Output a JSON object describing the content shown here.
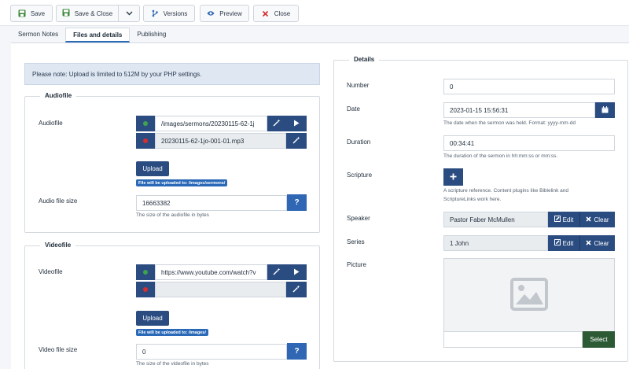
{
  "toolbar": {
    "save": "Save",
    "save_close": "Save & Close",
    "versions": "Versions",
    "preview": "Preview",
    "close": "Close"
  },
  "tabs": [
    {
      "label": "Sermon Notes"
    },
    {
      "label": "Files and details"
    },
    {
      "label": "Publishing"
    }
  ],
  "notice": "Please note: Upload is limited to 512M by your PHP settings.",
  "audio": {
    "legend": "Audiofile",
    "label": "Audiofile",
    "path": "/images/sermons/20230115-62-1j",
    "file": "20230115-62-1jo-001-01.mp3",
    "upload": "Upload",
    "upload_hint": "File will be uploaded to: /images/sermons/",
    "size_label": "Audio file size",
    "size_value": "16663382",
    "size_hint": "The size of the audiofile in bytes"
  },
  "video": {
    "legend": "Videofile",
    "label": "Videofile",
    "path": "https://www.youtube.com/watch?v",
    "file": "",
    "upload": "Upload",
    "upload_hint": "File will be uploaded to: /images/",
    "size_label": "Video file size",
    "size_value": "0",
    "size_hint": "The size of the videofile in bytes"
  },
  "details": {
    "legend": "Details",
    "number_label": "Number",
    "number_value": "0",
    "date_label": "Date",
    "date_value": "2023-01-15 15:56:31",
    "date_hint": "The date when the sermon was held. Format: yyyy-mm-dd",
    "duration_label": "Duration",
    "duration_value": "00:34:41",
    "duration_hint": "The duration of the sermon in hh:mm:ss or mm:ss.",
    "scripture_label": "Scripture",
    "scripture_hint_1": "A scripture reference. Content plugins like Biblelink and",
    "scripture_hint_2": "ScriptureLinks work here.",
    "speaker_label": "Speaker",
    "speaker_value": "Pastor Faber McMullen",
    "series_label": "Series",
    "series_value": "1 John",
    "edit": "Edit",
    "clear": "Clear",
    "picture_label": "Picture",
    "picture_value": "",
    "select": "Select"
  },
  "colors": {
    "primary": "#2a4c80",
    "info": "#2f67b5",
    "success_dot": "#3fa34d",
    "danger_dot": "#d32f2f",
    "select_btn": "#2c5a35"
  }
}
